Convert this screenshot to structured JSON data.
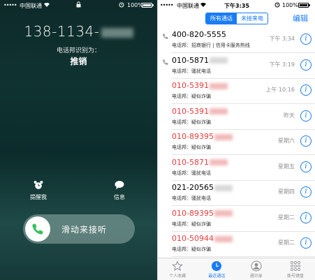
{
  "incoming_call": {
    "status_bar": {
      "signal": "•••••",
      "carrier": "中国联通",
      "battery_pct": "100%",
      "battery_level": 1.0
    },
    "number": "138-1134-",
    "identified_by": "电话邦识别为：",
    "category": "推销",
    "actions": {
      "remind_label": "提醒我",
      "message_label": "信息"
    },
    "slider_label": "滑动来接听"
  },
  "recents": {
    "status_bar": {
      "signal": "•••••",
      "carrier": "中国联通",
      "time": "下午3:35",
      "battery_pct": "100%",
      "battery_level": 1.0
    },
    "segments": [
      "所有通话",
      "未接来电"
    ],
    "active_segment": 0,
    "edit_label": "编辑",
    "calls": [
      {
        "number": "400-820-5555",
        "tag": "电话邦：招商银行 | 信用卡服务热线",
        "time": "下午 3:34",
        "missed": false,
        "outgoing": true
      },
      {
        "number": "010-5871",
        "tag": "电话邦：骚扰电话",
        "time": "下午 3:19",
        "missed": false,
        "outgoing": true
      },
      {
        "number": "010-5391",
        "tag": "电话邦：疑似诈骗",
        "time": "上午 10:16",
        "missed": true,
        "outgoing": false
      },
      {
        "number": "010-5391",
        "tag": "电话邦：疑似诈骗",
        "time": "昨天",
        "missed": true,
        "outgoing": false
      },
      {
        "number": "010-89395",
        "tag": "电话邦：疑似诈骗",
        "time": "星期六",
        "missed": true,
        "outgoing": false
      },
      {
        "number": "010-5871",
        "tag": "电话邦：骚扰电话",
        "time": "星期五",
        "missed": true,
        "outgoing": false
      },
      {
        "number": "021-20565",
        "tag": "电话邦：骚扰电话",
        "time": "星期四",
        "missed": false,
        "outgoing": false
      },
      {
        "number": "010-89395",
        "tag": "电话邦：疑似诈骗",
        "time": "星期二",
        "missed": true,
        "outgoing": false
      },
      {
        "number": "010-50944",
        "tag": "电话邦：疑似诈骗",
        "time": "星期二",
        "missed": true,
        "outgoing": false
      }
    ],
    "info_glyph": "i",
    "tabs": [
      {
        "label": "个人收藏",
        "icon": "star-icon"
      },
      {
        "label": "最近通话",
        "icon": "clock-icon"
      },
      {
        "label": "通讯录",
        "icon": "contacts-icon"
      },
      {
        "label": "拨号键盘",
        "icon": "keypad-icon"
      }
    ],
    "active_tab": 1,
    "accent_color": "#1a7cf5",
    "missed_color": "#ea3b3b"
  }
}
